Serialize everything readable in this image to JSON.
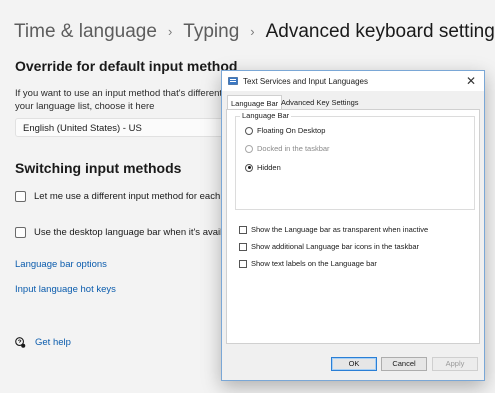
{
  "breadcrumb": {
    "items": [
      "Time & language",
      "Typing",
      "Advanced keyboard settings"
    ],
    "separator": "›"
  },
  "override": {
    "title": "Override for default input method",
    "desc_line1": "If you want to use an input method that's different th",
    "desc_line2": "your language list, choose it here",
    "selected": "English (United States) - US"
  },
  "switching": {
    "title": "Switching input methods",
    "option1": "Let me use a different input method for each app",
    "option2": "Use the desktop language bar when it's available"
  },
  "links": {
    "language_bar_options": "Language bar options",
    "input_hot_keys": "Input language hot keys",
    "get_help": "Get help"
  },
  "dialog": {
    "title": "Text Services and Input Languages",
    "close": "✕",
    "tabs": [
      "Language Bar",
      "Advanced Key Settings"
    ],
    "group_label": "Language Bar",
    "radios": [
      {
        "label": "Floating On Desktop",
        "checked": false,
        "disabled": false
      },
      {
        "label": "Docked in the taskbar",
        "checked": false,
        "disabled": true
      },
      {
        "label": "Hidden",
        "checked": true,
        "disabled": false
      }
    ],
    "checkboxes": [
      "Show the Language bar as transparent when inactive",
      "Show additional Language bar icons in the taskbar",
      "Show text labels on the Language bar"
    ],
    "buttons": {
      "ok": "OK",
      "cancel": "Cancel",
      "apply": "Apply"
    }
  },
  "colors": {
    "link": "#0b5cad",
    "dialog_border": "#7aa7d6",
    "default_button_border": "#2a7fd6"
  }
}
